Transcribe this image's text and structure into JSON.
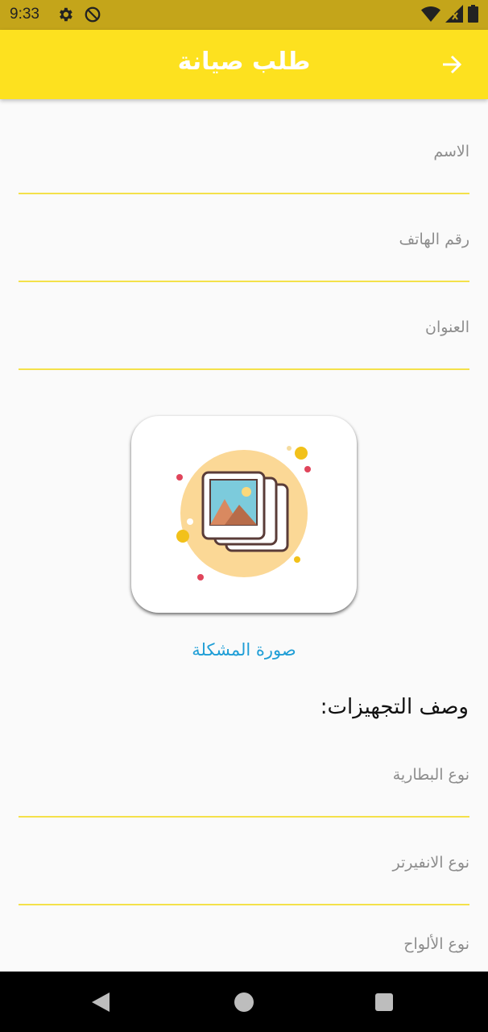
{
  "status_bar": {
    "time": "9:33",
    "icons": [
      "gear-icon",
      "dnd-icon",
      "wifi-icon",
      "signal-icon",
      "battery-icon"
    ]
  },
  "app_bar": {
    "title": "طلب صيانة",
    "background": "#fde11f",
    "back_icon": "arrow-right-icon"
  },
  "form": {
    "name_label": "الاسم",
    "phone_label": "رقم الهاتف",
    "address_label": "العنوان",
    "photo_caption": "صورة المشكلة",
    "equipment_heading": "وصف التجهيزات:",
    "battery_label": "نوع البطارية",
    "inverter_label": "نوع الانفيرتر",
    "panels_label": "نوع الألواح"
  },
  "colors": {
    "accent": "#fde11f",
    "underline": "#f4e14a",
    "link": "#1f9ed6",
    "status_bar": "#c4a51a"
  },
  "nav_bar": {
    "icons": [
      "back-triangle-icon",
      "home-circle-icon",
      "recents-square-icon"
    ]
  }
}
